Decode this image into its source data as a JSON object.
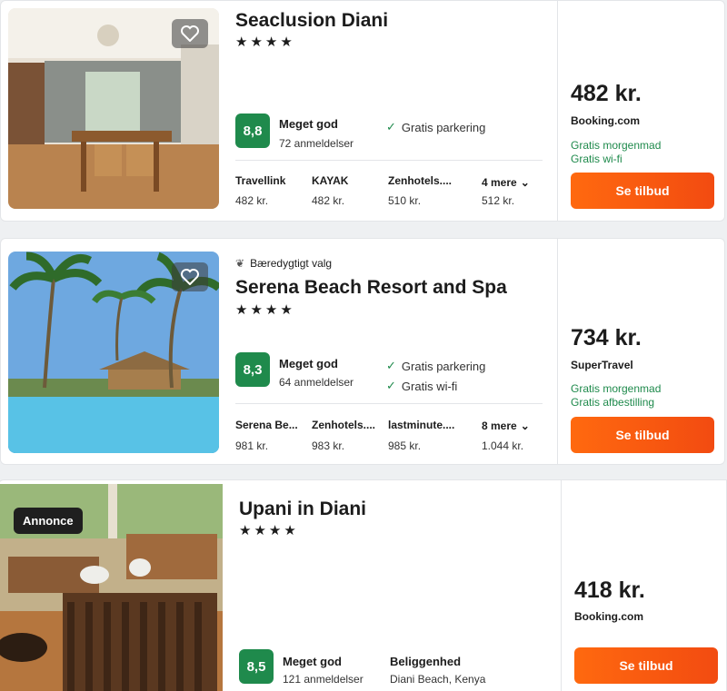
{
  "results": [
    {
      "name": "Seaclusion Diani",
      "stars": "★★★★",
      "eco_label": "",
      "score": "8,8",
      "rating_word": "Meget god",
      "reviews": "72 anmeldelser",
      "amenities": [
        "Gratis parkering"
      ],
      "providers": [
        {
          "name": "Travellink",
          "price": "482 kr."
        },
        {
          "name": "KAYAK",
          "price": "482 kr."
        },
        {
          "name": "Zenhotels....",
          "price": "510 kr."
        }
      ],
      "more": {
        "label": "4 mere",
        "price": "512 kr."
      },
      "price": "482 kr.",
      "site": "Booking.com",
      "perks": [
        "Gratis morgenmad",
        "Gratis wi-fi"
      ],
      "cta": "Se tilbud"
    },
    {
      "name": "Serena Beach Resort and Spa",
      "stars": "★★★★",
      "eco_label": "Bæredygtigt valg",
      "score": "8,3",
      "rating_word": "Meget god",
      "reviews": "64 anmeldelser",
      "amenities": [
        "Gratis parkering",
        "Gratis wi-fi"
      ],
      "providers": [
        {
          "name": "Serena Be...",
          "price": "981 kr."
        },
        {
          "name": "Zenhotels....",
          "price": "983 kr."
        },
        {
          "name": "lastminute....",
          "price": "985 kr."
        }
      ],
      "more": {
        "label": "8 mere",
        "price": "1.044 kr."
      },
      "price": "734 kr.",
      "site": "SuperTravel",
      "perks": [
        "Gratis morgenmad",
        "Gratis afbestilling"
      ],
      "cta": "Se tilbud"
    },
    {
      "name": "Upani in Diani",
      "stars": "★★★★",
      "ad_badge": "Annonce",
      "score": "8,5",
      "rating_word": "Meget god",
      "reviews": "121 anmeldelser",
      "location_label": "Beliggenhed",
      "location_value": "Diani Beach, Kenya",
      "price": "418 kr.",
      "site": "Booking.com",
      "cta": "Se tilbud"
    }
  ],
  "colors": {
    "score_bg": "#1f8a4c",
    "cta_start": "#ff690f",
    "cta_end": "#f24b11",
    "perk": "#1f8a4c"
  }
}
